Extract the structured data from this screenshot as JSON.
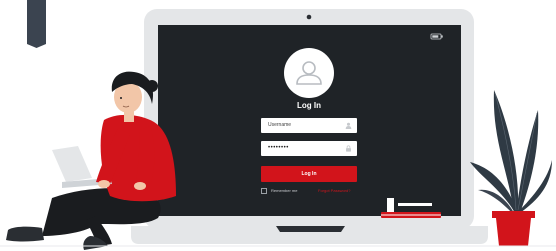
{
  "login": {
    "title": "Log In",
    "username_placeholder": "Username",
    "password_masked": "••••••••",
    "login_label": "Log In",
    "remember_label": "Remember me",
    "forgot_label": "Forgot Password?"
  },
  "colors": {
    "accent": "#d2141b",
    "screen": "#1f2327",
    "laptop_body": "#e4e6e8",
    "bookmark": "#3b4450",
    "plant_leaf": "#2f3a44"
  },
  "icons": [
    "avatar-icon",
    "user-icon",
    "lock-icon",
    "battery-icon",
    "checkbox-icon",
    "bookmark-icon"
  ]
}
